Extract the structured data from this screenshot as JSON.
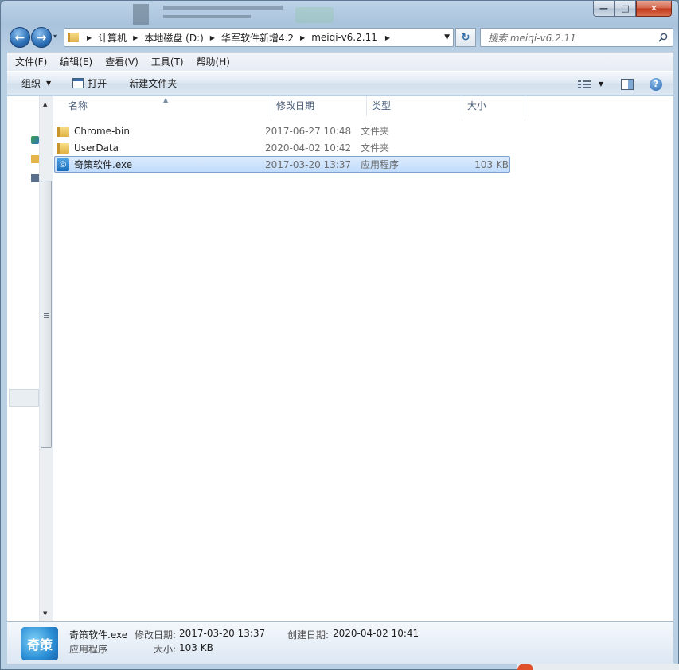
{
  "window": {
    "caption": {
      "minimize": "—",
      "maximize": "□",
      "close": "✕"
    }
  },
  "nav": {
    "back": "←",
    "forward": "→",
    "recent": "▾",
    "breadcrumbs": [
      "计算机",
      "本地磁盘 (D:)",
      "华军软件新增4.2",
      "meiqi-v6.2.11"
    ],
    "refresh": "↻",
    "search_placeholder": "搜索 meiqi-v6.2.11"
  },
  "menu": {
    "items": [
      "文件(F)",
      "编辑(E)",
      "查看(V)",
      "工具(T)",
      "帮助(H)"
    ]
  },
  "commands": {
    "organize": "组织",
    "open": "打开",
    "new_folder": "新建文件夹",
    "help": "?"
  },
  "columns": {
    "name": "名称",
    "date": "修改日期",
    "type": "类型",
    "size": "大小"
  },
  "files": [
    {
      "name": "Chrome-bin",
      "date": "2017-06-27 10:48",
      "type": "文件夹",
      "size": "",
      "icon": "folder-icon",
      "selected": false
    },
    {
      "name": "UserData",
      "date": "2020-04-02 10:42",
      "type": "文件夹",
      "size": "",
      "icon": "folder-icon",
      "selected": false
    },
    {
      "name": "奇策软件.exe",
      "date": "2017-03-20 13:37",
      "type": "应用程序",
      "size": "103 KB",
      "icon": "exe-icon",
      "selected": true
    }
  ],
  "details": {
    "name": "奇策软件.exe",
    "type": "应用程序",
    "modified_label": "修改日期:",
    "modified_value": "2017-03-20 13:37",
    "size_label": "大小:",
    "size_value": "103 KB",
    "created_label": "创建日期:",
    "created_value": "2020-04-02 10:41",
    "icon_text": "奇策"
  },
  "colors": {
    "selection": "#c1dcfc",
    "selection_border": "#7da2ce",
    "chrome": "#b9cfe4"
  }
}
